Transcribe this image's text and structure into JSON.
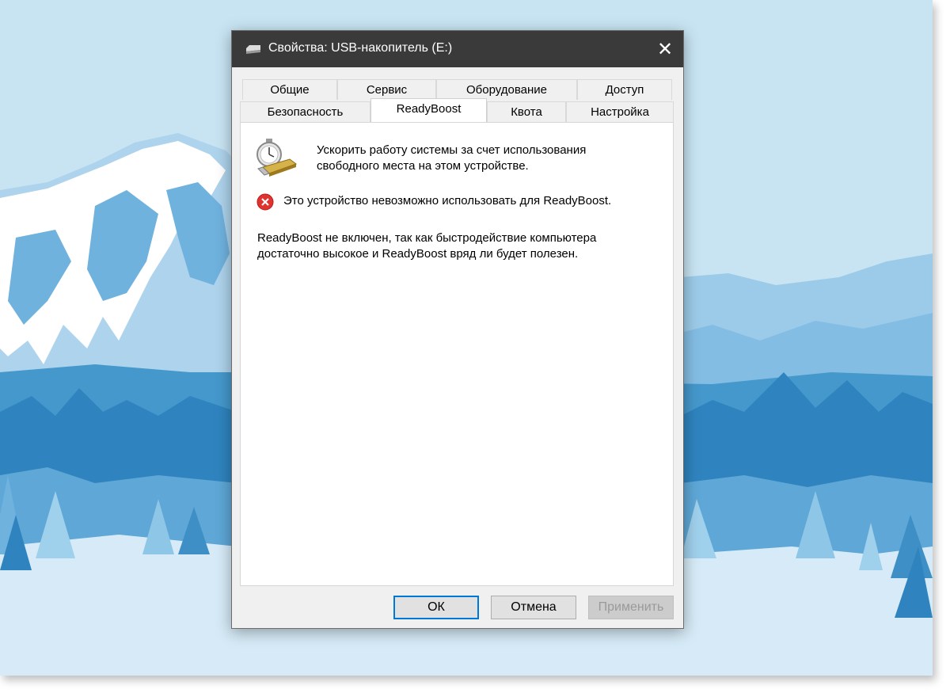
{
  "dialog": {
    "title": "Свойства: USB-накопитель (E:)",
    "close_glyph": "✕",
    "tabs_row1": [
      "Общие",
      "Сервис",
      "Оборудование",
      "Доступ"
    ],
    "tabs_row2": [
      "Безопасность",
      "ReadyBoost",
      "Квота",
      "Настройка"
    ],
    "active_tab": "ReadyBoost",
    "intro_text": "Ускорить работу системы за счет использования свободного места на этом устройстве.",
    "error_text": "Это устройство невозможно использовать для ReadyBoost.",
    "info_text": "ReadyBoost не включен, так как быстродействие компьютера достаточно высокое и ReadyBoost вряд ли будет полезен.",
    "buttons": {
      "ok": "ОК",
      "cancel": "Отмена",
      "apply": "Применить"
    }
  },
  "colors": {
    "titlebar": "#3a3a3a",
    "accent": "#0078d7",
    "error": "#e0322f"
  },
  "icons": {
    "title": "usb-drive-icon",
    "readyboost": "readyboost-stopwatch-icon",
    "error": "error-icon"
  }
}
